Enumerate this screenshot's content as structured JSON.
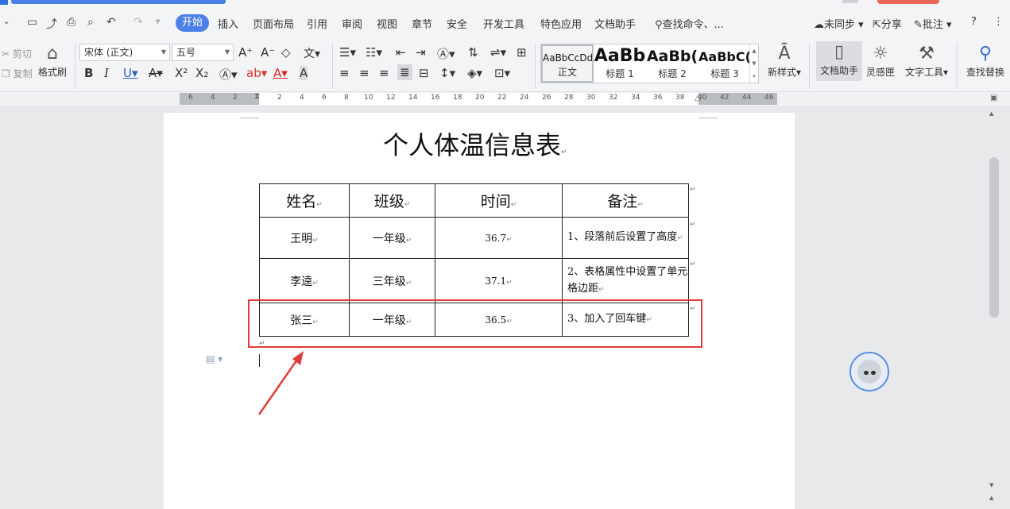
{
  "menubar": {
    "tabs": [
      "开始",
      "插入",
      "页面布局",
      "引用",
      "审阅",
      "视图",
      "章节",
      "安全",
      "开发工具",
      "特色应用",
      "文档助手"
    ],
    "active_tab": "开始",
    "search": "查找命令、...",
    "sync": "未同步",
    "share": "分享",
    "comment": "批注",
    "help": "?"
  },
  "ribbon": {
    "cut": "剪切",
    "copy": "复制",
    "format_painter": "格式刷",
    "font_name": "宋体 (正文)",
    "font_size": "五号",
    "styles": [
      {
        "preview": "AaBbCcDd",
        "caption": "正文"
      },
      {
        "preview": "AaBb",
        "caption": "标题 1"
      },
      {
        "preview": "AaBb(",
        "caption": "标题 2"
      },
      {
        "preview": "AaBbC(",
        "caption": "标题 3"
      }
    ],
    "new_style": "新样式",
    "doc_assistant": "文档助手",
    "inspiration": "灵感匣",
    "text_tools": "文字工具",
    "find_replace": "查找替换"
  },
  "ruler": {
    "ticks_left": [
      "6",
      "4",
      "2"
    ],
    "ticks_right": [
      "2",
      "4",
      "6",
      "8",
      "10",
      "12",
      "14",
      "16",
      "18",
      "20",
      "22",
      "24",
      "26",
      "28",
      "30",
      "32",
      "34",
      "36",
      "38",
      "40",
      "42",
      "44",
      "46"
    ]
  },
  "document": {
    "title": "个人体温信息表",
    "table": {
      "headers": [
        "姓名",
        "班级",
        "时间",
        "备注"
      ],
      "rows": [
        [
          "王明",
          "一年级",
          "36.7",
          "1、段落前后设置了高度"
        ],
        [
          "李逵",
          "三年级",
          "37.1",
          "2、表格属性中设置了单元格边距"
        ],
        [
          "张三",
          "一年级",
          "36.5",
          "3、加入了回车键"
        ]
      ]
    }
  },
  "colors": {
    "accent": "#4d80e6",
    "highlight_box": "#e23b3b"
  }
}
